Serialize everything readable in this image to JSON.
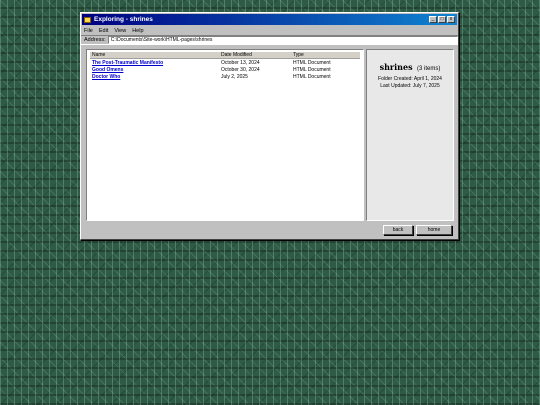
{
  "window": {
    "title": "Exploring - shrines",
    "controls": [
      "_",
      "□",
      "x"
    ]
  },
  "menu": {
    "items": [
      "File",
      "Edit",
      "View",
      "Help"
    ]
  },
  "address": {
    "label": "Address:",
    "value": "C:\\Documents\\Site-work\\HTML-pages\\shrines"
  },
  "columns": {
    "name": "Name",
    "date": "Date Modified",
    "type": "Type"
  },
  "files": [
    {
      "name": "The Post-Traumatic Manifesto",
      "date": "October 13, 2024",
      "type": "HTML Document"
    },
    {
      "name": "Good Omens",
      "date": "October 30, 2024",
      "type": "HTML Document"
    },
    {
      "name": "Doctor Who",
      "date": "July 2, 2025",
      "type": "HTML Document"
    }
  ],
  "info": {
    "folder": "shrines",
    "count": "(3 items)",
    "created": "Folder Created: April 1, 2024",
    "updated": "Last Updated: July 7, 2025"
  },
  "buttons": {
    "back": "back",
    "home": "home"
  },
  "colors": {
    "titlebar_start": "#000080",
    "titlebar_end": "#1084d0",
    "link": "#0000cc",
    "chrome": "#c0c0c0"
  }
}
